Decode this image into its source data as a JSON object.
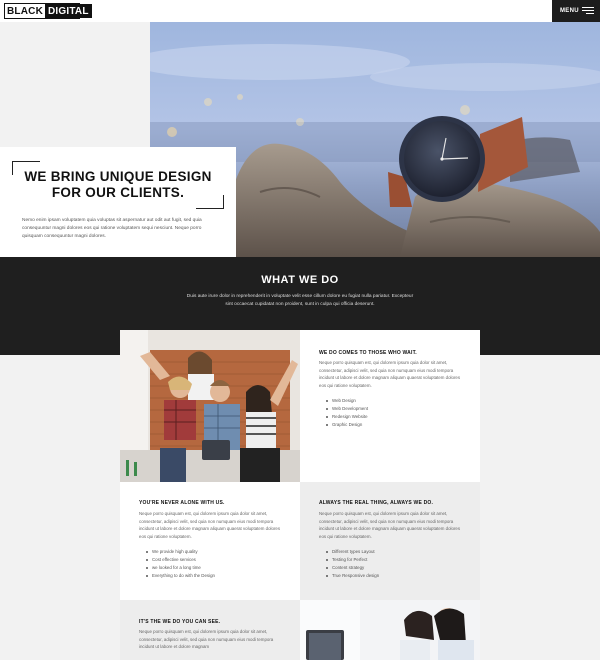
{
  "header": {
    "logo_black": "BLACK",
    "logo_digital": "DIGITAL",
    "menu_label": "MENU"
  },
  "hero": {
    "title_line1": "WE BRING UNIQUE DESIGN",
    "title_line2": "FOR OUR CLIENTS.",
    "text": "Nemo enim ipsam voluptatem quia voluptas sit aspernatur aut odit aut fugit, sed quia consequuntur magni dolores eos qui ratione voluptatem sequi nesciunt. Neque porro quisquam consequuntur magni dolores."
  },
  "what_we_do": {
    "title": "WHAT WE DO",
    "text": "Duis aute irure dolor in reprehenderit in voluptate velit esse cillum dolore eu fugiat nulla pariatur. Excepteur sint occaecat cupidatat non proident, sunt in culpa qui officia deserunt."
  },
  "blocks": {
    "b1": {
      "heading": "WE DO COMES TO THOSE WHO WAIT.",
      "text": "Neque porro quisquam est, qui dolorem ipsum quia dolor sit amet, consectetur, adipisci velit, sed quia non numquam eius modi tempora incidunt ut labore et dolore magnam aliquam quaerat voluptatem dolores eos qui ratione voluptatem.",
      "items": [
        "Web Design",
        "Web Development",
        "Redesign Website",
        "Graphic Design"
      ]
    },
    "b2": {
      "heading": "YOU'RE NEVER ALONE WITH US.",
      "text": "Neque porro quisquam est, qui dolorem ipsum quia dolor sit amet, consectetur, adipisci velit, sed quia non numquam eius modi tempora incidunt ut labore et dolore magnam aliquam quaerat voluptatem dolores eos qui ratione voluptatem.",
      "items": [
        "We provide high quality",
        "Cost effective services",
        "we looked for a long time",
        "Everything to do with the Design"
      ]
    },
    "b3": {
      "heading": "ALWAYS THE REAL THING, ALWAYS WE DO.",
      "text": "Neque porro quisquam est, qui dolorem ipsum quia dolor sit amet, consectetur, adipisci velit, sed quia non numquam eius modi tempora incidunt ut labore et dolore magnam aliquam quaerat voluptatem dolores eos qui ratione voluptatem.",
      "items": [
        "Different types Layout",
        "Testing for Perfect",
        "Content strategy",
        "True Responsive design"
      ]
    },
    "b4": {
      "heading": "IT'S THE WE DO YOU CAN SEE.",
      "text": "Neque porro quisquam est, qui dolorem ipsum quia dolor sit amet, consectetur, adipisci velit, sed quia non numquam eius modi tempora incidunt ut labore et dolore magnam"
    }
  },
  "colors": {
    "dark": "#1f1f1f",
    "white": "#ffffff",
    "light_grey": "#ededed",
    "page_bg": "#f2f2f2"
  }
}
